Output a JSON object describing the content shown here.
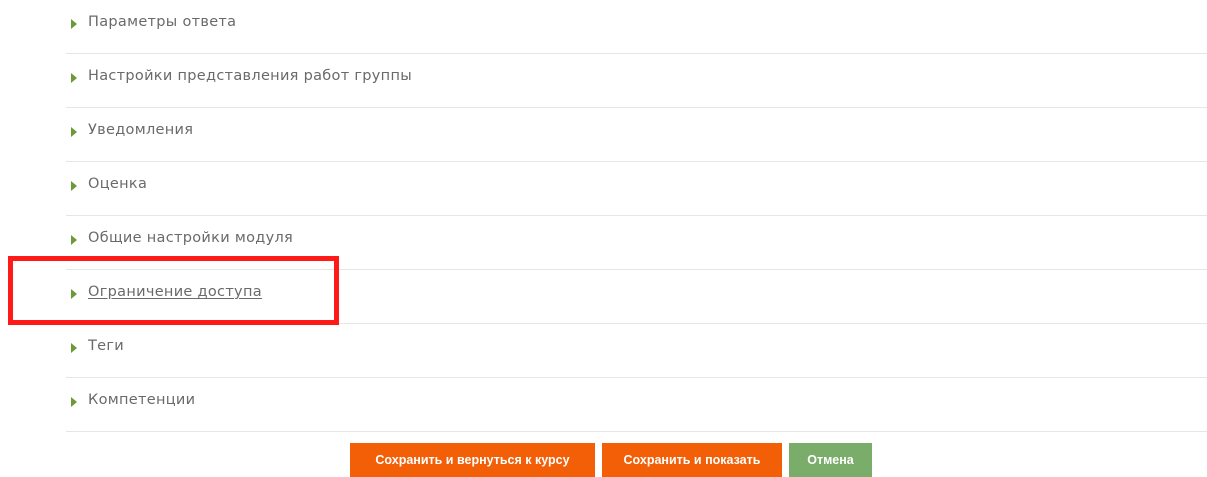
{
  "sections": [
    {
      "label": "Параметры ответа"
    },
    {
      "label": "Настройки представления работ группы"
    },
    {
      "label": "Уведомления"
    },
    {
      "label": "Оценка"
    },
    {
      "label": "Общие настройки модуля"
    },
    {
      "label": "Ограничение доступа"
    },
    {
      "label": "Теги"
    },
    {
      "label": "Компетенции"
    }
  ],
  "buttons": {
    "save_return_label": "Сохранить и вернуться к курсу",
    "save_show_label": "Сохранить и показать",
    "cancel_label": "Отмена"
  },
  "colors": {
    "accent_orange": "#f25f07",
    "cancel_green": "#7aad6a",
    "highlight_red": "#ff1a1a",
    "expander_green": "#6b9a37"
  }
}
